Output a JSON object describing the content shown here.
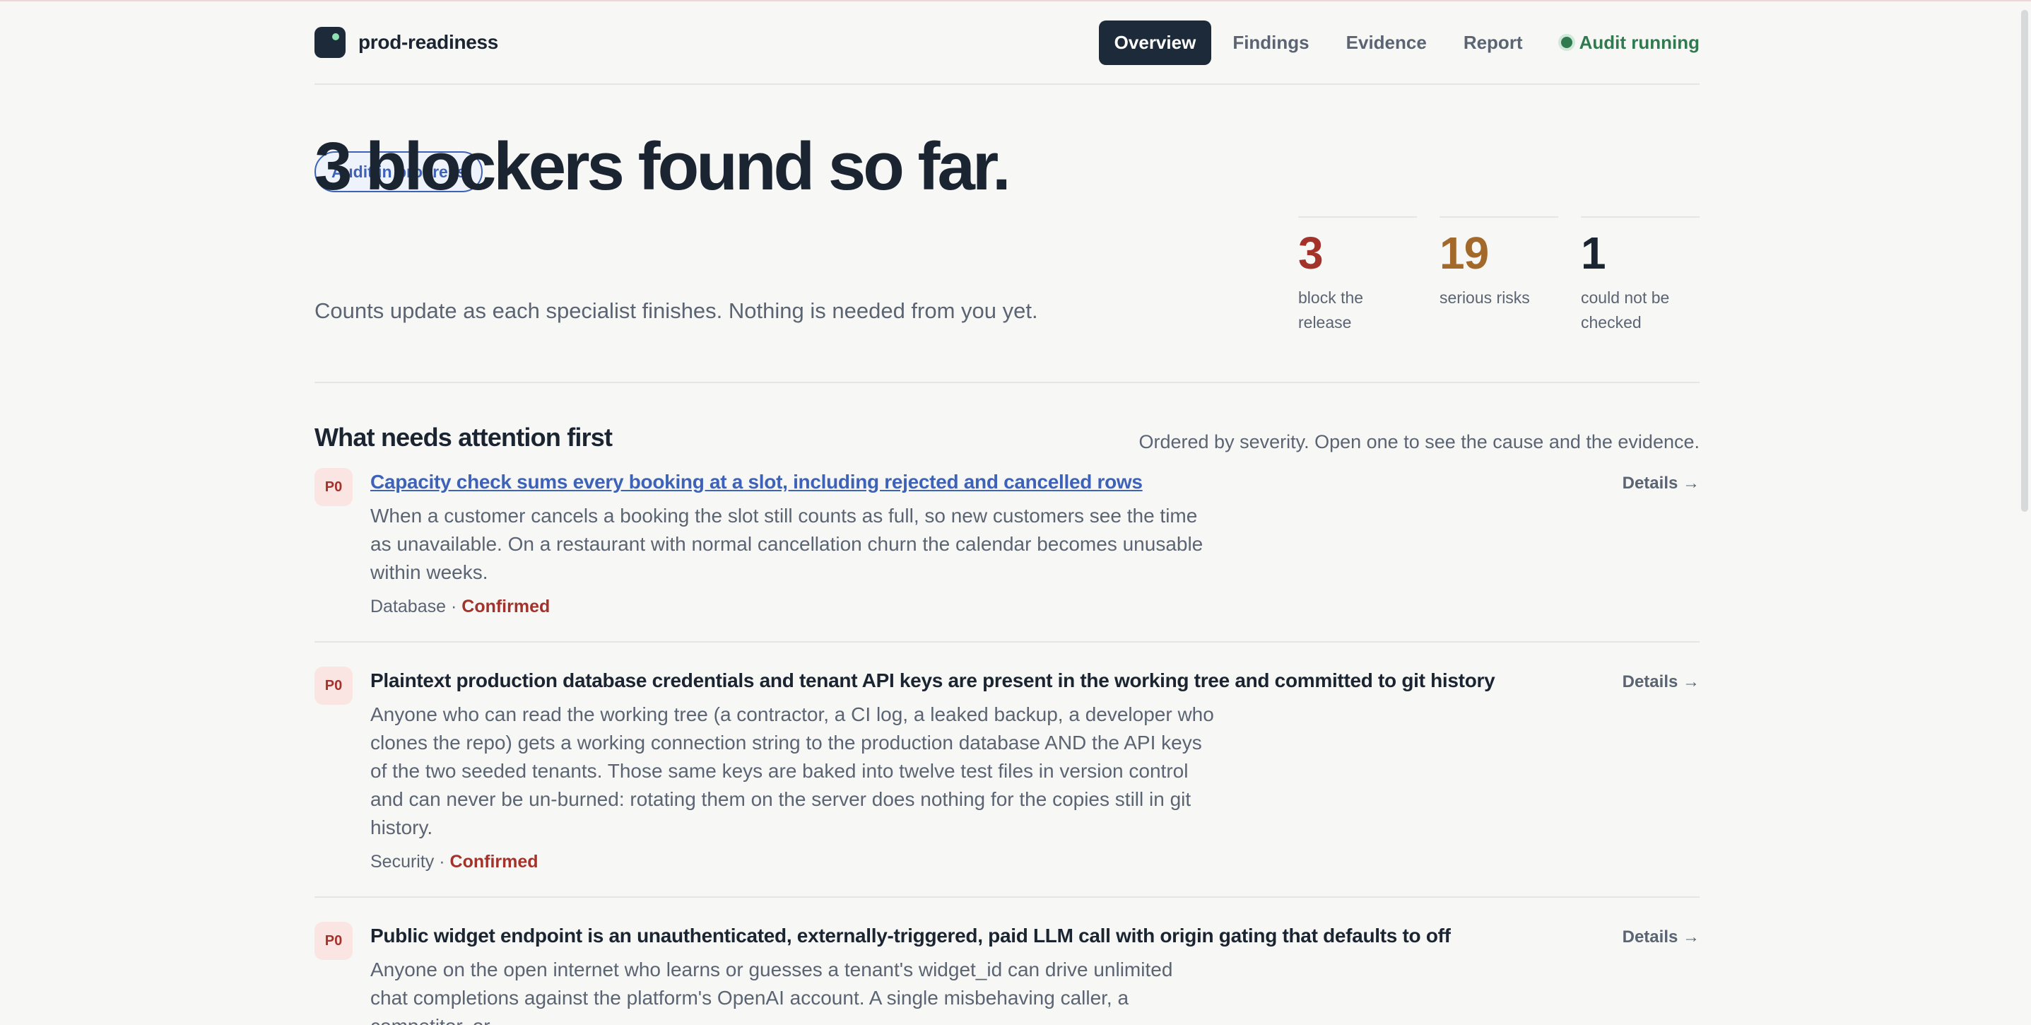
{
  "app": {
    "name": "prod-readiness"
  },
  "nav": {
    "tabs": [
      {
        "label": "Overview"
      },
      {
        "label": "Findings"
      },
      {
        "label": "Evidence"
      },
      {
        "label": "Report"
      }
    ],
    "status": "Audit running"
  },
  "hero": {
    "badge": "Audit in progress",
    "title": "3 blockers found so far.",
    "subtitle": "Counts update as each specialist finishes. Nothing is needed from you yet.",
    "stats": [
      {
        "value": "3",
        "label": "block the release",
        "color": "#a3322b"
      },
      {
        "value": "19",
        "label": "serious risks",
        "color": "#a2692a"
      },
      {
        "value": "1",
        "label": "could not be checked",
        "color": "#1b2431"
      }
    ]
  },
  "attention": {
    "title": "What needs attention first",
    "hint": "Ordered by severity. Open one to see the cause and the evidence.",
    "details_label": "Details →",
    "findings": [
      {
        "priority": "P0",
        "title": "Capacity check sums every booking at a slot, including rejected and cancelled rows",
        "body": "When a customer cancels a booking the slot still counts as full, so new customers see the time as unavailable. On a restaurant with normal cancellation churn the calendar becomes unusable within weeks.",
        "area": "Database",
        "separator": "·",
        "status": "Confirmed"
      },
      {
        "priority": "P0",
        "title": "Plaintext production database credentials and tenant API keys are present in the working tree and committed to git history",
        "body": "Anyone who can read the working tree (a contractor, a CI log, a leaked backup, a developer who clones the repo) gets a working connection string to the production database AND the API keys of the two seeded tenants. Those same keys are baked into twelve test files in version control and can never be un-burned: rotating them on the server does nothing for the copies still in git history.",
        "area": "Security",
        "separator": "·",
        "status": "Confirmed"
      },
      {
        "priority": "P0",
        "title": "Public widget endpoint is an unauthenticated, externally-triggered, paid LLM call with origin gating that defaults to off",
        "body": "Anyone on the open internet who learns or guesses a tenant's widget_id can drive unlimited chat completions against the platform's OpenAI account. A single misbehaving caller, a competitor, or",
        "area": "",
        "separator": "",
        "status": ""
      }
    ]
  }
}
